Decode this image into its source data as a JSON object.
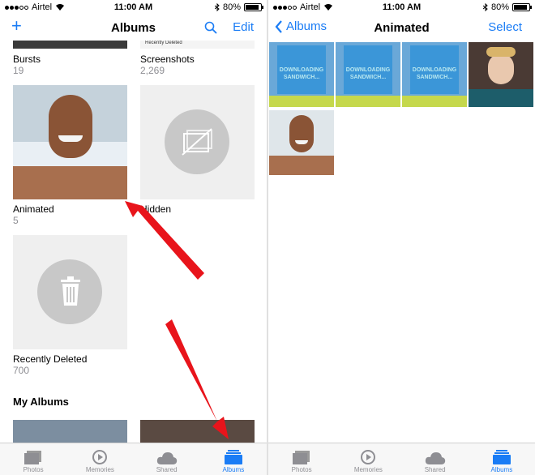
{
  "status": {
    "carrier": "Airtel",
    "time": "11:00 AM",
    "battery": "80%",
    "battery_level": 0.8
  },
  "left": {
    "nav": {
      "title": "Albums",
      "add": "+",
      "edit": "Edit"
    },
    "top_row": [
      {
        "name": "Bursts",
        "count": "19"
      },
      {
        "name": "Screenshots",
        "count": "2,269",
        "peek_text": "Recently Deleted"
      }
    ],
    "albums": [
      {
        "name": "Animated",
        "count": "5"
      },
      {
        "name": "Hidden",
        "count": ""
      },
      {
        "name": "Recently Deleted",
        "count": "700"
      }
    ],
    "section_title": "My Albums"
  },
  "right": {
    "nav": {
      "back": "Albums",
      "title": "Animated",
      "select": "Select"
    },
    "downloading_text": "DOWNLOADING SANDWICH..."
  },
  "tabs": [
    {
      "label": "Photos"
    },
    {
      "label": "Memories"
    },
    {
      "label": "Shared"
    },
    {
      "label": "Albums"
    }
  ],
  "colors": {
    "accent": "#1a7cf5",
    "arrow": "#e8141b"
  }
}
